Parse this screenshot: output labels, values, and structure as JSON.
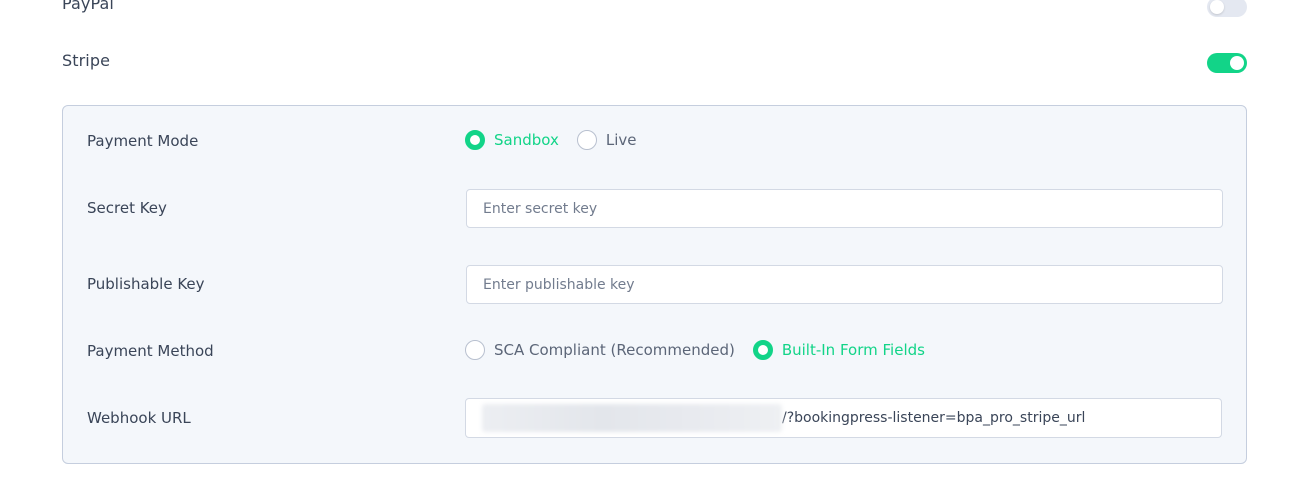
{
  "gateways": {
    "paypal": {
      "label": "PayPal",
      "enabled": false
    },
    "stripe": {
      "label": "Stripe",
      "enabled": true
    }
  },
  "stripe_settings": {
    "payment_mode": {
      "label": "Payment Mode",
      "options": [
        {
          "label": "Sandbox",
          "selected": true
        },
        {
          "label": "Live",
          "selected": false
        }
      ]
    },
    "secret_key": {
      "label": "Secret Key",
      "value": "",
      "placeholder": "Enter secret key"
    },
    "publishable_key": {
      "label": "Publishable Key",
      "value": "",
      "placeholder": "Enter publishable key"
    },
    "payment_method": {
      "label": "Payment Method",
      "options": [
        {
          "label": "SCA Compliant (Recommended)",
          "selected": false
        },
        {
          "label": "Built-In Form Fields",
          "selected": true
        }
      ]
    },
    "webhook_url": {
      "label": "Webhook URL",
      "value_suffix": "/?bookingpress-listener=bpa_pro_stripe_url"
    }
  },
  "colors": {
    "accent": "#12d488",
    "toggle_off": "#e4e8f1",
    "panel_bg": "#f4f7fb",
    "panel_border": "#c5cede",
    "text": "#3a4558"
  }
}
